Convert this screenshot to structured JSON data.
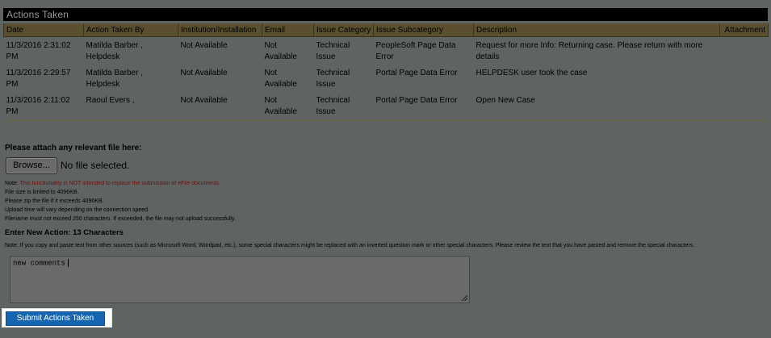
{
  "panel": {
    "title": "Actions Taken"
  },
  "table": {
    "headers": [
      "Date",
      "Action Taken By",
      "Institution/Installation",
      "Email",
      "Issue Category",
      "Issue Subcategory",
      "Description",
      "Attachment"
    ],
    "rows": [
      {
        "date": "11/3/2016 2:31:02 PM",
        "by": "Matilda Barber , Helpdesk",
        "institution": "Not Available",
        "email": "Not Available",
        "category": "Technical Issue",
        "subcategory": "PeopleSoft Page Data Error",
        "description": "Request for more Info: Returning case. Please return with more details",
        "attachment": ""
      },
      {
        "date": "11/3/2016 2:29:57 PM",
        "by": "Matilda Barber , Helpdesk",
        "institution": "Not Available",
        "email": "Not Available",
        "category": "Technical Issue",
        "subcategory": "Portal Page Data Error",
        "description": "HELPDESK user took the case",
        "attachment": ""
      },
      {
        "date": "11/3/2016 2:11:02 PM",
        "by": "Raoul Evers ,",
        "institution": "Not Available",
        "email": "Not Available",
        "category": "Technical Issue",
        "subcategory": "Portal Page Data Error",
        "description": "Open New Case",
        "attachment": ""
      }
    ]
  },
  "attach": {
    "label": "Please attach any relevant file here:",
    "browse_label": "Browse...",
    "file_status": "No file selected."
  },
  "notes": {
    "prefix": "Note: ",
    "warning": "This functionality is NOT intended to replace the submission of eFile documents.",
    "lines": [
      "File size is limited to 4096KB.",
      "Please zip the file if it exceeds 4096KB.",
      "Upload time will vary depending on the connection speed.",
      "Filename must not exceed 250 characters. If exceeded, the file may not upload successfully."
    ]
  },
  "new_action": {
    "label": "Enter New Action: 13 Characters",
    "copy_note": "Note: If you copy and paste text from other sources (such as Microsoft Word, Wordpad, etc.), some special characters might be replaced with an inverted question mark or other special characters. Please review the text that you have pasted and remove the special characters.",
    "value": "new comments"
  },
  "submit": {
    "label": "Submit Actions Taken"
  },
  "colors": {
    "page_bg": "#5f6462",
    "header_bg": "#5a4f2e",
    "title_bar": "#000000",
    "warning_text": "#6b0f0f",
    "submit_bg": "#1565b0"
  }
}
